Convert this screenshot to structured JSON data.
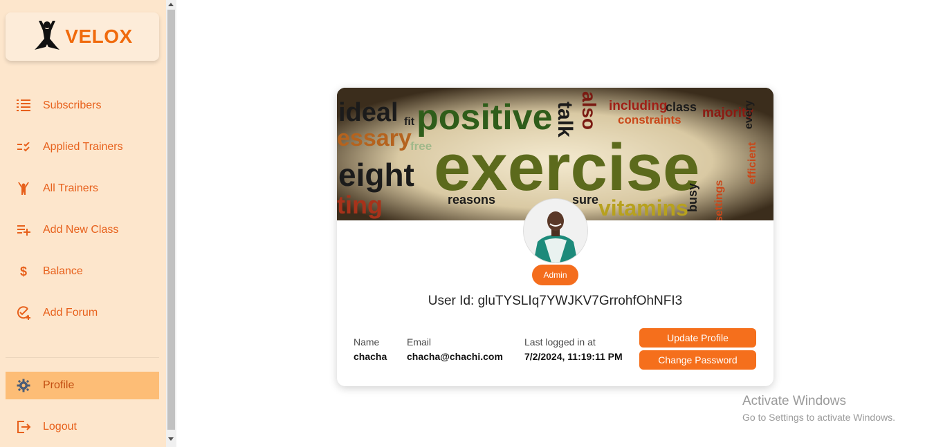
{
  "brand": {
    "logo_text": "VELOX"
  },
  "sidebar": {
    "items": [
      {
        "label": "Subscribers",
        "icon": "list-icon"
      },
      {
        "label": "Applied Trainers",
        "icon": "checklist-icon"
      },
      {
        "label": "All Trainers",
        "icon": "trainer-icon"
      },
      {
        "label": "Add New Class",
        "icon": "playlist-add-icon"
      },
      {
        "label": "Balance",
        "icon": "dollar-icon"
      },
      {
        "label": "Add Forum",
        "icon": "add-circle-check-icon"
      }
    ],
    "bottom": [
      {
        "label": "Profile",
        "icon": "gear-icon",
        "active": true
      },
      {
        "label": "Logout",
        "icon": "logout-icon"
      }
    ]
  },
  "profile": {
    "banner_words": [
      "ideal",
      "positive",
      "talk",
      "also",
      "including",
      "class",
      "majority",
      "essary",
      "fit",
      "constraints",
      "free",
      "exercise",
      "eight",
      "reasons",
      "sure",
      "vitamins",
      "ting",
      "busy",
      "settings",
      "efficient",
      "every"
    ],
    "role": "Admin",
    "user_id_text": "User Id: gluTYSLIq7YWJKV7GrrohfOhNFI3",
    "name_label": "Name",
    "name_value": "chacha",
    "email_label": "Email",
    "email_value": "chacha@chachi.com",
    "last_login_label": "Last logged in at",
    "last_login_value": "7/2/2024, 11:19:11 PM",
    "update_button": "Update Profile",
    "change_password_button": "Change Password"
  },
  "windows_watermark": {
    "title": "Activate Windows",
    "subtitle": "Go to Settings to activate Windows."
  },
  "colors": {
    "accent": "#f56f1c",
    "sidebar_bg": "#fde6cc",
    "active_bg": "#fdbd76",
    "nav_text": "#e7601b"
  }
}
